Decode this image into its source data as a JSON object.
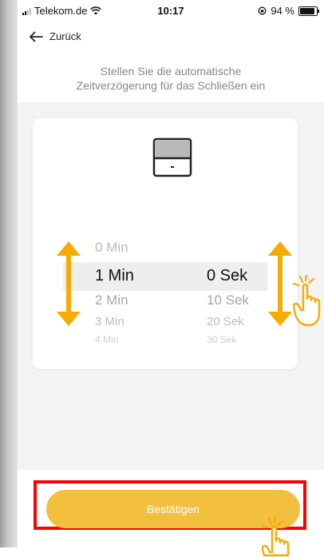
{
  "status_bar": {
    "carrier": "Telekom.de",
    "time": "10:17",
    "battery": "94 %"
  },
  "header": {
    "back_label": "Zurück",
    "back_icon": "arrow-left-icon"
  },
  "instruction": {
    "line1": "Stellen Sie die automatische",
    "line2": "Zeitverzögerung für das Schließen ein"
  },
  "device": {
    "icon": "garage-door-icon"
  },
  "picker": {
    "minutes": [
      "0 Min",
      "1 Min",
      "2 Min",
      "3 Min",
      "4 Min"
    ],
    "seconds": [
      "",
      "0 Sek",
      "10 Sek",
      "20 Sek",
      "30 Sek"
    ],
    "selected_minutes": "1 Min",
    "selected_seconds": "0 Sek"
  },
  "confirm": {
    "label": "Bestätigen"
  },
  "colors": {
    "accent": "#f3bf3f",
    "arrow": "#f6ab00",
    "highlight": "#ff0000"
  }
}
